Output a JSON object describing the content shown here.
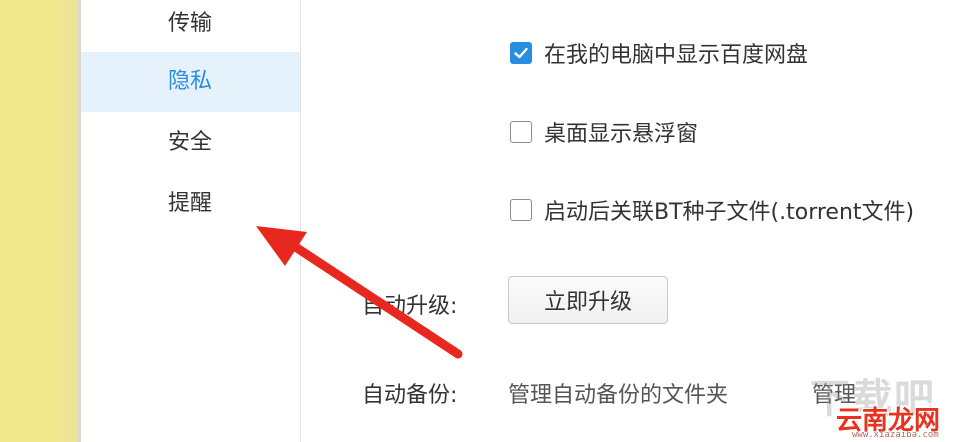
{
  "sidebar": {
    "items": [
      {
        "label": "传输",
        "active": false
      },
      {
        "label": "隐私",
        "active": true
      },
      {
        "label": "安全",
        "active": false
      },
      {
        "label": "提醒",
        "active": false
      }
    ]
  },
  "options": {
    "show_in_computer": {
      "label": "在我的电脑中显示百度网盘",
      "checked": true
    },
    "desktop_float": {
      "label": "桌面显示悬浮窗",
      "checked": false
    },
    "associate_bt": {
      "label": "启动后关联BT种子文件(.torrent文件)",
      "checked": false
    }
  },
  "auto_upgrade": {
    "label": "自动升级:",
    "button_label": "立即升级"
  },
  "auto_backup": {
    "label": "自动备份:",
    "description": "管理自动备份的文件夹",
    "manage_label": "管理"
  },
  "watermark": {
    "text": "云南龙网",
    "url": "www.xiazaiba.com",
    "bg_text": "下载吧"
  },
  "colors": {
    "accent": "#2a8ee0",
    "active_bg": "#e5f1fb",
    "arrow": "#e8281e",
    "left_strip": "#f0e98a"
  },
  "icons": {
    "checkmark": "check-icon",
    "pointer": "red-arrow-annotation"
  }
}
